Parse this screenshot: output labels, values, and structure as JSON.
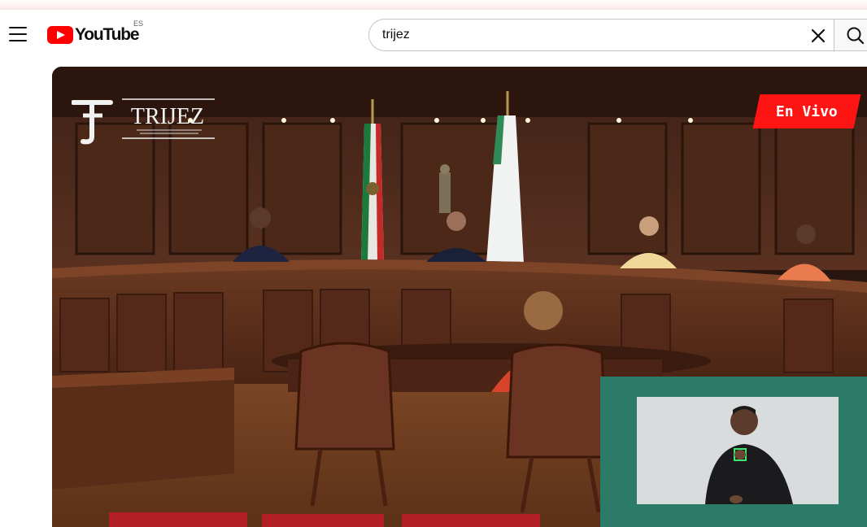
{
  "header": {
    "logo_text": "YouTube",
    "country_code": "ES",
    "search": {
      "value": "trijez"
    }
  },
  "video": {
    "channel_logo_text": "TRIJEZ",
    "live_badge": "En Vivo"
  },
  "icons": [
    "menu-icon",
    "youtube-logo",
    "clear-icon",
    "search-icon"
  ],
  "colors": {
    "brand_red": "#FF0000",
    "live_red": "#FF1414",
    "sign_panel": "#2C7A68"
  }
}
